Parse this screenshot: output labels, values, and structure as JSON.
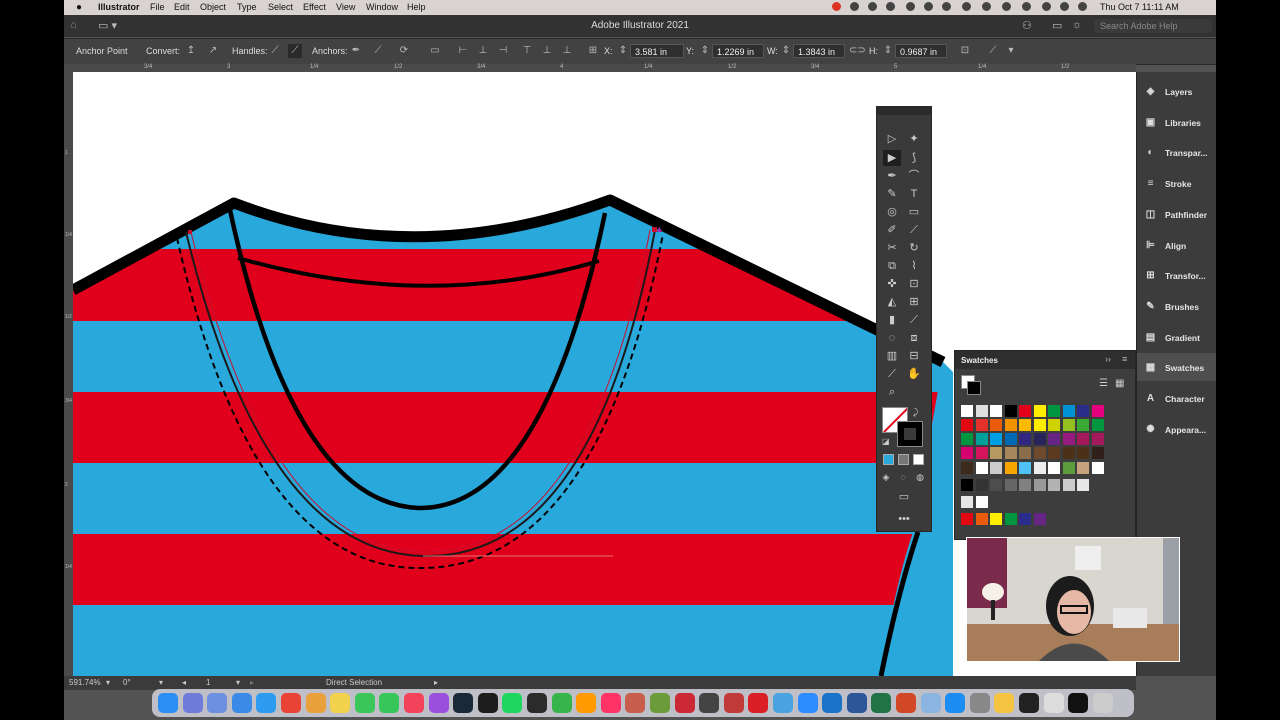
{
  "menubar": {
    "app": "Illustrator",
    "items": [
      "File",
      "Edit",
      "Object",
      "Type",
      "Select",
      "Effect",
      "View",
      "Window",
      "Help"
    ],
    "clock": "Thu Oct 7  11:11 AM"
  },
  "titlebar": {
    "title": "Adobe Illustrator 2021",
    "search_placeholder": "Search Adobe Help"
  },
  "controlbar": {
    "mode": "Anchor Point",
    "convert": "Convert:",
    "handles": "Handles:",
    "anchors": "Anchors:",
    "x_label": "X:",
    "x_value": "3.581 in",
    "y_label": "Y:",
    "y_value": "1.2269 in",
    "w_label": "W:",
    "w_value": "1.3843 in",
    "h_label": "H:",
    "h_value": "0.9687 in"
  },
  "rulers": {
    "top_ticks": [
      "3/4",
      "3",
      "1/4",
      "1/2",
      "3/4",
      "4",
      "1/4",
      "1/2",
      "3/4",
      "5",
      "1/4",
      "1/2"
    ],
    "left_ticks": [
      "1",
      "1/4",
      "1/2",
      "3/4",
      "2",
      "1/4"
    ]
  },
  "statusbar": {
    "zoom": "591.74%",
    "rotation": "0°",
    "artboard": "1",
    "tool": "Direct Selection"
  },
  "panels": [
    {
      "name": "Layers",
      "icon": "layers-icon",
      "glyph": "◈"
    },
    {
      "name": "Libraries",
      "icon": "libraries-icon",
      "glyph": "▣"
    },
    {
      "name": "Transpar...",
      "icon": "transparency-icon",
      "glyph": "◐"
    },
    {
      "name": "Stroke",
      "icon": "stroke-icon",
      "glyph": "≡"
    },
    {
      "name": "Pathfinder",
      "icon": "pathfinder-icon",
      "glyph": "◫"
    },
    {
      "name": "Align",
      "icon": "align-icon",
      "glyph": "⊫"
    },
    {
      "name": "Transfor...",
      "icon": "transform-icon",
      "glyph": "⊞"
    },
    {
      "name": "Brushes",
      "icon": "brushes-icon",
      "glyph": "✎"
    },
    {
      "name": "Gradient",
      "icon": "gradient-icon",
      "glyph": "▤"
    },
    {
      "name": "Swatches",
      "icon": "swatches-icon",
      "glyph": "▦"
    },
    {
      "name": "Character",
      "icon": "character-icon",
      "glyph": "A"
    },
    {
      "name": "Appeara...",
      "icon": "appearance-icon",
      "glyph": "✺"
    }
  ],
  "swatches_panel": {
    "title": "Swatches"
  },
  "colors": {
    "stripe_red": "#e0001b",
    "stripe_blue": "#29a8dc",
    "path_red": "#c8102e",
    "swatch_rows": [
      [
        "#ffffff",
        "#dedede",
        "#ffffff",
        "#000000",
        "#e3001b",
        "#ffed00",
        "#00963f",
        "#0092d2",
        "#2a2d8c",
        "#e5007d"
      ],
      [
        "#e30613",
        "#e4322b",
        "#ea5b0c",
        "#f39200",
        "#fbba00",
        "#ffed00",
        "#cfd400",
        "#95c11f",
        "#3aaa35",
        "#009640"
      ],
      [
        "#009640",
        "#00a19a",
        "#009fe3",
        "#0069b4",
        "#312783",
        "#29235c",
        "#662483",
        "#951b81",
        "#a3195b",
        "#a3195b"
      ],
      [
        "#d6006e",
        "#d4145a",
        "#b5995e",
        "#a6875b",
        "#8a6e4b",
        "#6f4a2c",
        "#5b3a20",
        "#4d3116",
        "#4d3116",
        "#2f2119"
      ],
      [
        "#3c2a1c",
        "#ffffff",
        "#cccccc",
        "#f7a600",
        "#4fc3f7",
        "#eeeeee",
        "#ffffff",
        "#5d9c3e",
        "#c6a37c",
        "#ffffff"
      ],
      [
        "#000000",
        "#333333",
        "#4d4d4d",
        "#666666",
        "#808080",
        "#999999",
        "#b3b3b3",
        "#cccccc",
        "#e6e6e6"
      ],
      [
        "#e6e6e6",
        "#ffffff"
      ],
      [
        "#e30613",
        "#ea5b0c",
        "#ffed00",
        "#00963f",
        "#2a2d8c",
        "#662483"
      ]
    ]
  }
}
